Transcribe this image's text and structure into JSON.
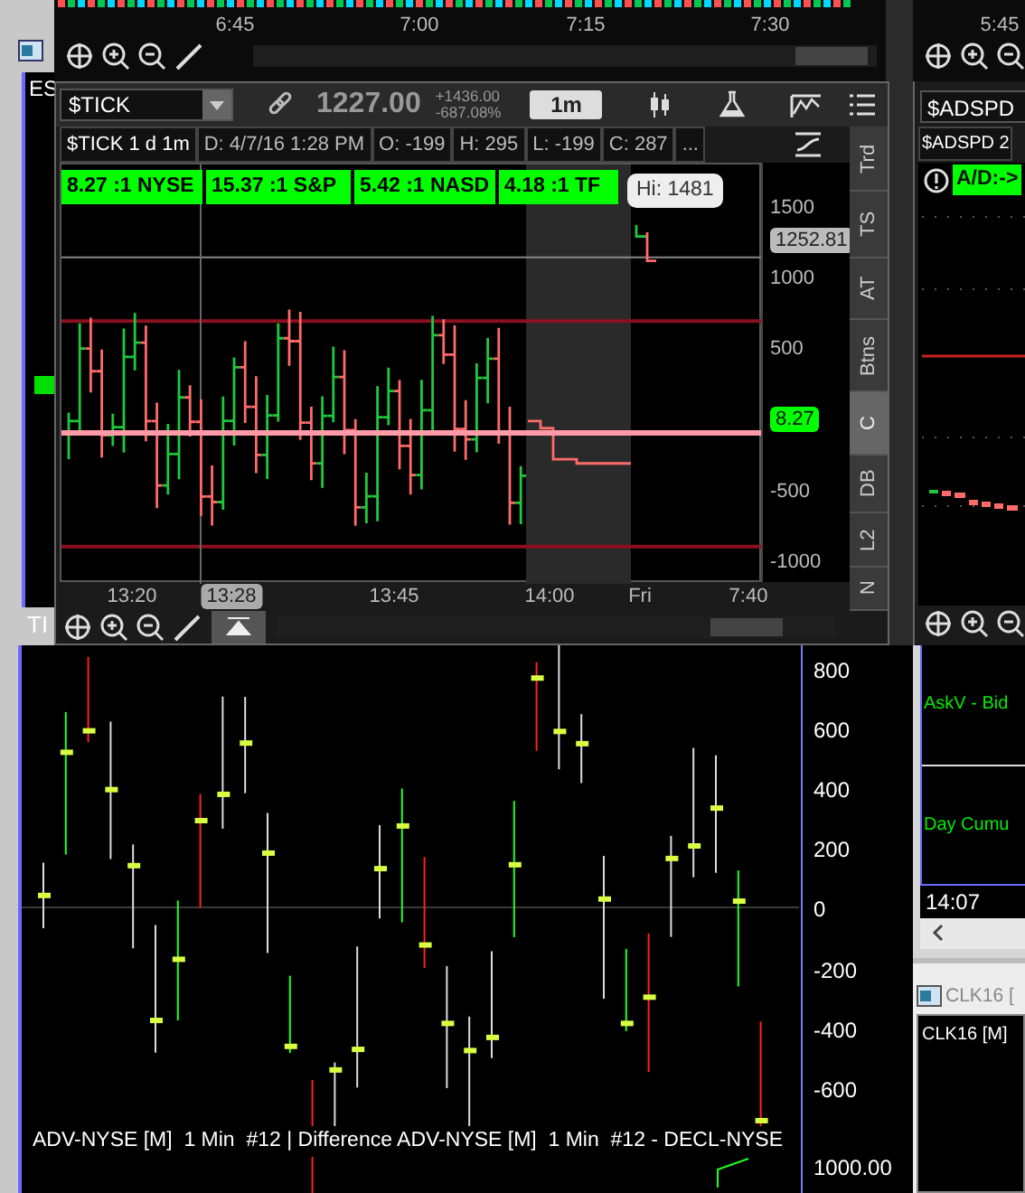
{
  "top_chart": {
    "time_labels": [
      "6:45",
      "7:00",
      "7:15",
      "7:30"
    ]
  },
  "top_right_chart": {
    "time_labels": [
      "5:45"
    ]
  },
  "left_window": {
    "chart_label": "ES",
    "lower_label": "TI"
  },
  "tick_window": {
    "symbol": "$TICK",
    "last": "1227.00",
    "change": "+1436.00",
    "change_pct": "-687.08%",
    "aggregation": "1m",
    "info": [
      "$TICK 1 d 1m",
      "D: 4/7/16 1:28 PM",
      "O: -199",
      "H: 295",
      "L: -199",
      "C: 287",
      "..."
    ],
    "ratios": [
      "8.27 :1 NYSE",
      "15.37 :1 S&P",
      "5.42 :1 NASD",
      "4.18 :1 TF"
    ],
    "tooltip": "Hi: 1481",
    "price_axis": [
      {
        "label": "1500",
        "kind": "tick"
      },
      {
        "label": "1252.81",
        "kind": "marker"
      },
      {
        "label": "1000",
        "kind": "tick"
      },
      {
        "label": "500",
        "kind": "tick"
      },
      {
        "label": "8.27",
        "kind": "current"
      },
      {
        "label": "-500",
        "kind": "tick"
      },
      {
        "label": "-1000",
        "kind": "tick"
      }
    ],
    "time_axis": [
      {
        "label": "13:20",
        "selected": false
      },
      {
        "label": "13:28",
        "selected": true
      },
      {
        "label": "13:45",
        "selected": false
      },
      {
        "label": "14:00",
        "selected": false
      },
      {
        "label": "Fri",
        "selected": false
      },
      {
        "label": "7:40",
        "selected": false
      }
    ],
    "side_tabs": [
      {
        "label": "Trd",
        "selected": false
      },
      {
        "label": "TS",
        "selected": false
      },
      {
        "label": "AT",
        "selected": false
      },
      {
        "label": "Btns",
        "selected": false
      },
      {
        "label": "C",
        "selected": true
      },
      {
        "label": "DB",
        "selected": false
      },
      {
        "label": "L2",
        "selected": false
      },
      {
        "label": "N",
        "selected": false
      }
    ]
  },
  "adspd_window": {
    "symbol": "$ADSPD",
    "title": "$ADSPD 2",
    "study": "A/D:->"
  },
  "bottom_chart": {
    "y_axis": [
      "800",
      "600",
      "400",
      "200",
      "0",
      "-200",
      "-400",
      "-600",
      "1000.00"
    ],
    "legend": "ADV-NYSE [M]  1 Min  #12 | Difference ADV-NYSE [M]  1 Min  #12 - DECL-NYSE"
  },
  "side_panel": {
    "rows": [
      "AskV - Bid",
      "Day Cumu"
    ],
    "time": "14:07"
  },
  "clk_window": {
    "title": "CLK16 [",
    "label": "CLK16 [M]"
  }
}
